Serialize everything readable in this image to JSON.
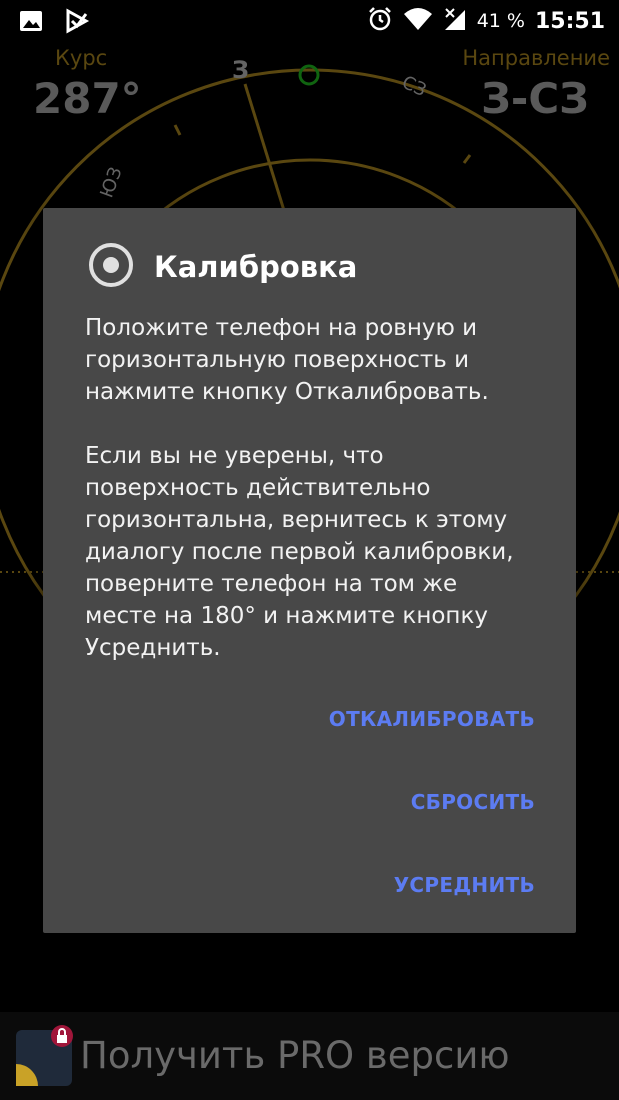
{
  "status_bar": {
    "battery_percent": "41 %",
    "time": "15:51"
  },
  "background": {
    "course_label": "Курс",
    "course_value": "287°",
    "direction_label": "Направление",
    "direction_value": "З-СЗ",
    "dial_labels": [
      "З",
      "СЗ",
      "ЮЗ"
    ],
    "accent_color": "#8a6d1a"
  },
  "dialog": {
    "title": "Калибровка",
    "body": "Положите телефон на ровную и горизонтальную поверхность и нажмите кнопку Откалибровать.\n\nЕсли вы не уверены, что поверхность действительно горизонтальна, вернитесь к этому диалогу после первой калибровки, поверните телефон на том же месте на 180° и нажмите кнопку Усреднить.",
    "buttons": {
      "calibrate": "ОТКАЛИБРОВАТЬ",
      "reset": "СБРОСИТЬ",
      "average": "УСРЕДНИТЬ"
    },
    "button_color": "#5c7cf2"
  },
  "promo": {
    "text": "Получить PRO версию"
  }
}
